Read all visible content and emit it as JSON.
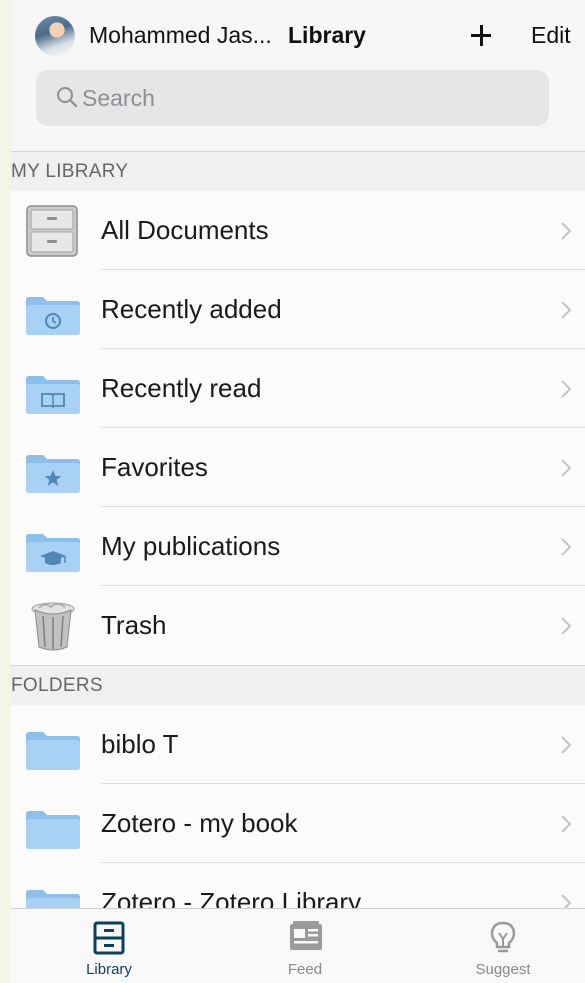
{
  "header": {
    "user_name": "Mohammed Jas...",
    "title": "Library",
    "edit_label": "Edit"
  },
  "search": {
    "placeholder": "Search"
  },
  "sections": {
    "my_library": "MY LIBRARY",
    "folders": "FOLDERS"
  },
  "library_items": [
    {
      "label": "All Documents",
      "icon": "file-cabinet-icon"
    },
    {
      "label": "Recently added",
      "icon": "clock-folder-icon"
    },
    {
      "label": "Recently read",
      "icon": "book-folder-icon"
    },
    {
      "label": "Favorites",
      "icon": "star-folder-icon"
    },
    {
      "label": "My publications",
      "icon": "graduation-cap-folder-icon"
    },
    {
      "label": "Trash",
      "icon": "trash-bin-icon"
    }
  ],
  "folder_items": [
    {
      "label": "biblo T",
      "icon": "folder-icon"
    },
    {
      "label": "Zotero - my book",
      "icon": "folder-icon"
    },
    {
      "label": "Zotero - Zotero Library",
      "icon": "folder-icon"
    }
  ],
  "tabs": [
    {
      "label": "Library",
      "active": true,
      "icon": "library-icon"
    },
    {
      "label": "Feed",
      "active": false,
      "icon": "feed-icon"
    },
    {
      "label": "Suggest",
      "active": false,
      "icon": "lightbulb-icon"
    }
  ],
  "colors": {
    "folder_blue": "#a9d1f5",
    "tab_active": "#0c3f5c",
    "tab_inactive": "#8a8a8a"
  }
}
